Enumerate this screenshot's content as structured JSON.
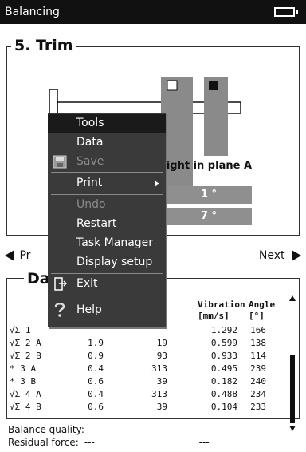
{
  "window": {
    "title": "Balancing"
  },
  "step": {
    "title": "5. Trim"
  },
  "diagram": {
    "heading": "eight in plane A",
    "value1": "1 °",
    "value2": "7 °"
  },
  "nav": {
    "prev": "Pr",
    "next": "Next"
  },
  "data_section": {
    "title": "Da"
  },
  "table": {
    "headers": {
      "vibration": "Vibration",
      "vibration_unit": "[mm/s]",
      "angle": "Angle",
      "angle_unit": "[°]"
    },
    "rows": [
      {
        "meas": "√Σ 1",
        "weight": "",
        "angle": "",
        "vibration": "1.292",
        "phase": "166"
      },
      {
        "meas": "√Σ 2 A",
        "weight": "1.9",
        "angle": "19",
        "vibration": "0.599",
        "phase": "138"
      },
      {
        "meas": "√Σ 2 B",
        "weight": "0.9",
        "angle": "93",
        "vibration": "0.933",
        "phase": "114"
      },
      {
        "meas": " * 3 A",
        "weight": "0.4",
        "angle": "313",
        "vibration": "0.495",
        "phase": "239"
      },
      {
        "meas": " * 3 B",
        "weight": "0.6",
        "angle": "39",
        "vibration": "0.182",
        "phase": "240"
      },
      {
        "meas": "√Σ 4 A",
        "weight": "0.4",
        "angle": "313",
        "vibration": "0.488",
        "phase": "234"
      },
      {
        "meas": "√Σ 4 B",
        "weight": "0.6",
        "angle": "39",
        "vibration": "0.104",
        "phase": "233"
      }
    ]
  },
  "footer": {
    "balance_quality_label": "Balance quality:",
    "balance_quality_value": "---",
    "residual_force_label": "Residual force:",
    "residual_force_value1": "---",
    "residual_force_value2": "---"
  },
  "menu": {
    "items": [
      {
        "label": "Tools",
        "icon": ""
      },
      {
        "label": "Data",
        "icon": ""
      },
      {
        "label": "Save",
        "icon": "floppy-disk-icon"
      },
      {
        "label": "Print",
        "icon": ""
      },
      {
        "label": "Undo",
        "icon": ""
      },
      {
        "label": "Restart",
        "icon": ""
      },
      {
        "label": "Task Manager",
        "icon": ""
      },
      {
        "label": "Display setup",
        "icon": ""
      },
      {
        "label": "Exit",
        "icon": "exit-door-icon"
      },
      {
        "label": "Help",
        "icon": "help-question-icon"
      }
    ]
  },
  "colors": {
    "titlebar_bg": "#111111",
    "menu_bg": "#3a3a3a",
    "value_box_bg": "#8f8f8f"
  }
}
